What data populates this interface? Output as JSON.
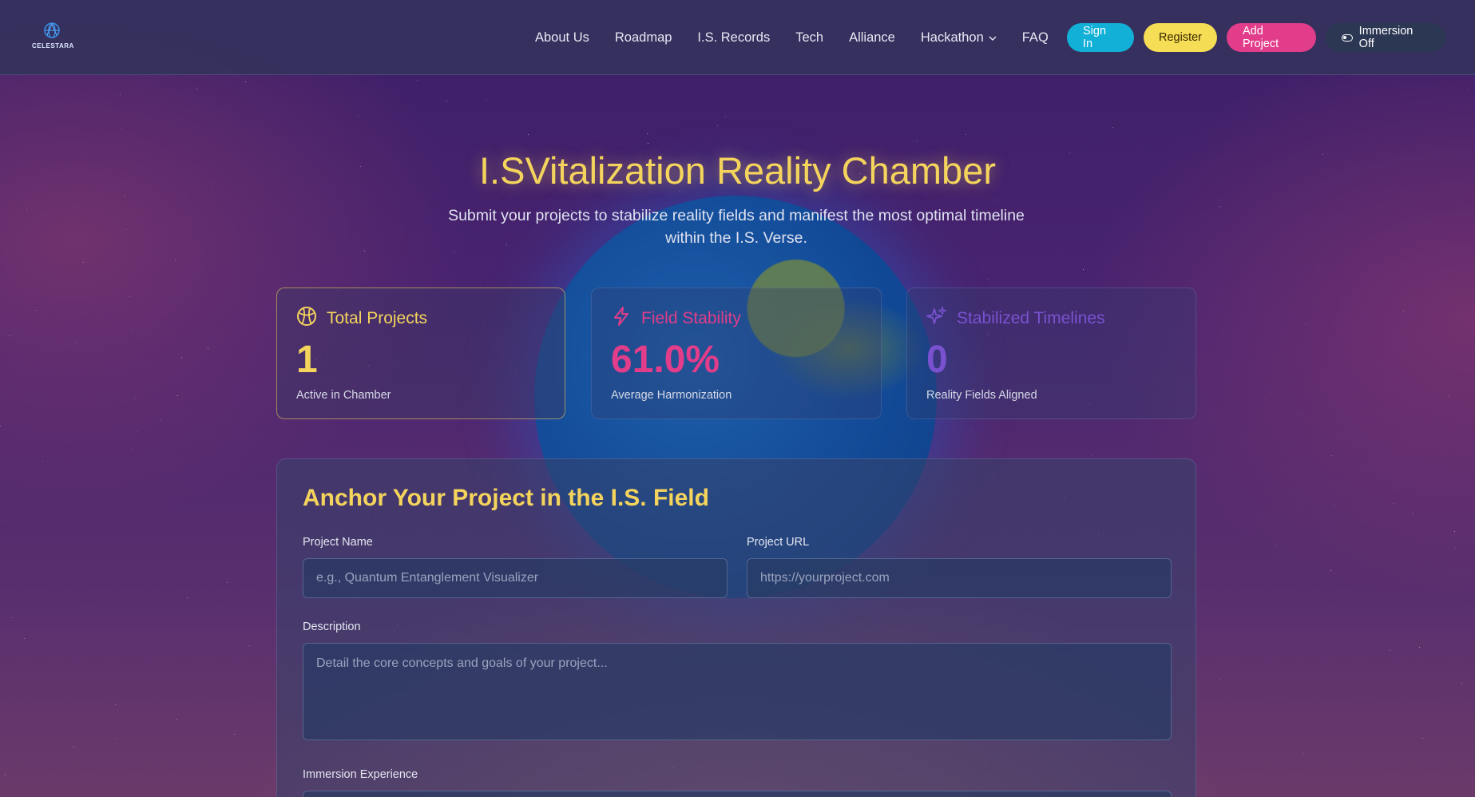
{
  "brand": {
    "logo_text": "CELESTARA"
  },
  "nav": {
    "items": [
      {
        "label": "About Us"
      },
      {
        "label": "Roadmap"
      },
      {
        "label": "I.S. Records"
      },
      {
        "label": "Tech"
      },
      {
        "label": "Alliance"
      },
      {
        "label": "Hackathon",
        "has_dropdown": true
      },
      {
        "label": "FAQ"
      }
    ],
    "signin_label": "Sign In",
    "register_label": "Register",
    "add_project_label": "Add Project",
    "immersion_label": "Immersion Off"
  },
  "hero": {
    "title": "I.SVitalization Reality Chamber",
    "subtitle": "Submit your projects to stabilize reality fields and manifest the most optimal timeline within the I.S. Verse."
  },
  "stats": [
    {
      "title": "Total Projects",
      "value": "1",
      "note": "Active in Chamber",
      "icon": "globe-network-icon",
      "color": "#f4d45c"
    },
    {
      "title": "Field Stability",
      "value": "61.0%",
      "note": "Average Harmonization",
      "icon": "lightning-icon",
      "color": "#e23d8a"
    },
    {
      "title": "Stabilized Timelines",
      "value": "0",
      "note": "Reality Fields Aligned",
      "icon": "sparkles-icon",
      "color": "#7a52d0"
    }
  ],
  "form": {
    "title": "Anchor Your Project in the I.S. Field",
    "project_name_label": "Project Name",
    "project_name_placeholder": "e.g., Quantum Entanglement Visualizer",
    "project_url_label": "Project URL",
    "project_url_placeholder": "https://yourproject.com",
    "description_label": "Description",
    "description_placeholder": "Detail the core concepts and goals of your project...",
    "immersion_label": "Immersion Experience"
  },
  "colors": {
    "accent_yellow": "#f4d45c",
    "accent_pink": "#e23d8a",
    "accent_cyan": "#12b0d6",
    "accent_purple": "#7a52d0"
  }
}
